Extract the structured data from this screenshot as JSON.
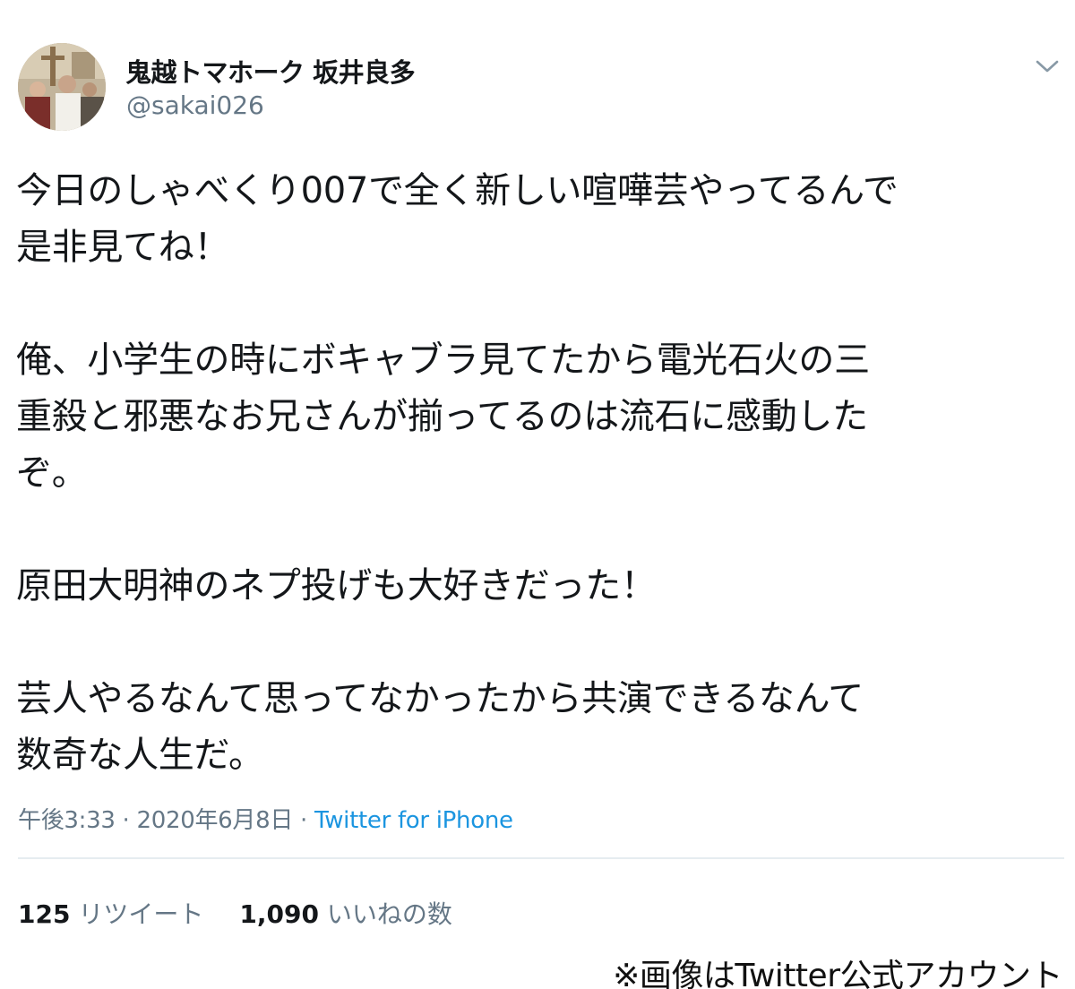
{
  "tweet": {
    "display_name": "鬼越トマホーク 坂井良多",
    "handle": "@sakai026",
    "paragraphs": [
      "今日のしゃべくり007で全く新しい喧嘩芸やってるんで\n是非見てね！",
      "俺、小学生の時にボキャブラ見てたから電光石火の三\n重殺と邪悪なお兄さんが揃ってるのは流石に感動した\nぞ。",
      "原田大明神のネプ投げも大好きだった！",
      "芸人やるなんて思ってなかったから共演できるなんて\n数奇な人生だ。"
    ],
    "time_date": "午後3:33 · 2020年6月8日 · ",
    "source": "Twitter for iPhone",
    "retweet_count": "125",
    "retweet_label": "リツイート",
    "like_count": "1,090",
    "like_label": "いいねの数",
    "menu_icon": "chevron-down-icon"
  },
  "credit": "※画像はTwitter公式アカウント",
  "colors": {
    "text": "#14171a",
    "secondary": "#657786",
    "link": "#1b95e0",
    "divider": "#e6ecf0"
  }
}
